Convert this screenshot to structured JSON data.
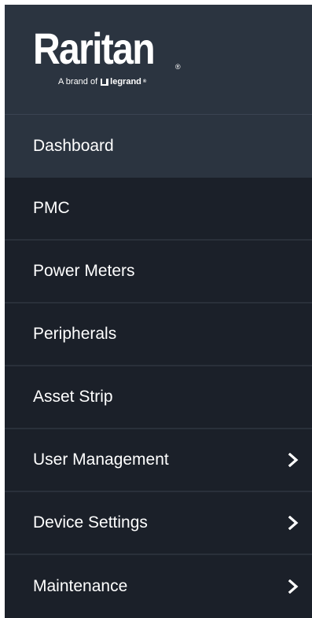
{
  "logo": {
    "wordmark": "Raritan",
    "registered": "®",
    "tagline": "A brand of",
    "brand": "legrand",
    "trademark": "®"
  },
  "nav": {
    "items": [
      {
        "label": "Dashboard",
        "active": true,
        "has_submenu": false
      },
      {
        "label": "PMC",
        "active": false,
        "has_submenu": false
      },
      {
        "label": "Power Meters",
        "active": false,
        "has_submenu": false
      },
      {
        "label": "Peripherals",
        "active": false,
        "has_submenu": false
      },
      {
        "label": "Asset Strip",
        "active": false,
        "has_submenu": false
      },
      {
        "label": "User Management",
        "active": false,
        "has_submenu": true,
        "icon": "chevron-right-icon"
      },
      {
        "label": "Device Settings",
        "active": false,
        "has_submenu": true,
        "icon": "chevron-right-icon"
      },
      {
        "label": "Maintenance",
        "active": false,
        "has_submenu": true,
        "icon": "chevron-right-icon"
      }
    ]
  },
  "colors": {
    "sidebar_bg": "#1b2029",
    "header_bg": "#2b3440",
    "active_bg": "#2b3440",
    "divider": "#2a303a",
    "text": "#ffffff"
  }
}
